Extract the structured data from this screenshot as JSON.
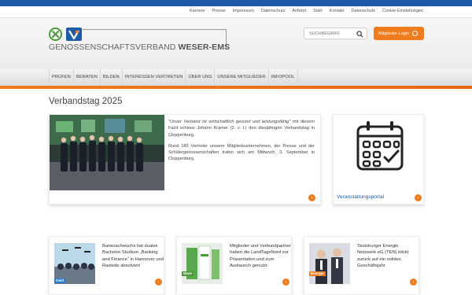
{
  "utility_nav": [
    "Karriere",
    "Presse",
    "Impressum",
    "Datenschutz",
    "Anfahrt",
    "Start",
    "Kontakt",
    "Datenschutz",
    "Cookie-Einstellungen"
  ],
  "header": {
    "org_name_light": "GENOSSENSCHAFTSVERBAND",
    "org_name_bold": "WESER-EMS",
    "search_placeholder": "SUCHBEGRIFF",
    "login_label": "Mitglieder-Login"
  },
  "nav": [
    "PRÜFEN",
    "BERATEN",
    "BILDEN",
    "INTERESSEN VERTRETEN",
    "ÜBER UNS",
    "UNSERE MITGLIEDER",
    "INFOPOOL"
  ],
  "main": {
    "title": "Verbandstag 2025",
    "feature": {
      "quote": "\"Unser Verband ist wirtschaftlich gesund und leistungsfähig\"",
      "para1_rest": " mit diesem Fazit schloss Johann Kramer (2. v. l.) den diesjährigen Verbandstag in Cloppenburg.",
      "para2": "Rund 180 Vertreter unserer Mitgliedsunternehmen, der Presse und der Schülergenossenschaften trafen sich am Mittwoch, 3. September in Cloppenburg."
    },
    "event_link": "Veranstaltungsportal"
  },
  "cards": [
    {
      "text": "Banknachwuchs hat duales Bachelor-Studium „Banking and Finance“ in Hannover und Rastede absolviert",
      "badge": "Geld"
    },
    {
      "text": "Mitglieder und Verbundpartner haben die LandTageNord zur Präsentation und zum Austausch genutzt",
      "badge": "Ware"
    },
    {
      "text": "Teutoburger Energie Netzwerk eG (TEN) blickt zurück auf ein solides Geschäftsjahr",
      "badge": "Energie"
    }
  ],
  "colors": {
    "brand_blue": "#1e5aa8",
    "accent_orange": "#f07c1e",
    "brand_green": "#4a9a3a"
  }
}
